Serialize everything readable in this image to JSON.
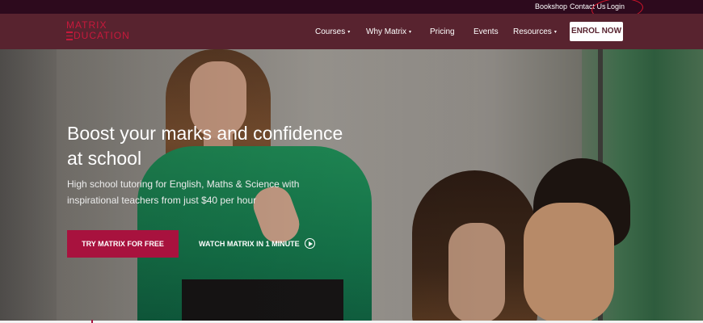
{
  "topbar": {
    "links": [
      "Bookshop",
      "Contact Us",
      "Login"
    ],
    "highlight_color": "#d4142a"
  },
  "brand": {
    "line1": "MATRIX",
    "line2": "DUCATION",
    "color": "#c8193c"
  },
  "nav": {
    "items": [
      {
        "label": "Courses",
        "has_dropdown": true
      },
      {
        "label": "Why Matrix",
        "has_dropdown": true
      },
      {
        "label": "Pricing",
        "has_dropdown": false
      },
      {
        "label": "Events",
        "has_dropdown": false
      },
      {
        "label": "Resources",
        "has_dropdown": true
      }
    ],
    "dropdown_glyph": "▾",
    "cta": "ENROL NOW",
    "background": "#58232f"
  },
  "hero": {
    "headline": "Boost your marks and confidence at school",
    "subtext": "High school tutoring for English, Maths & Science with inspirational teachers from just $40 per hour",
    "primary_button": "TRY MATRIX FOR FREE",
    "secondary_button": "WATCH MATRIX IN 1 MINUTE",
    "secondary_icon": "play-circle-icon",
    "accent": "#a8123e"
  }
}
